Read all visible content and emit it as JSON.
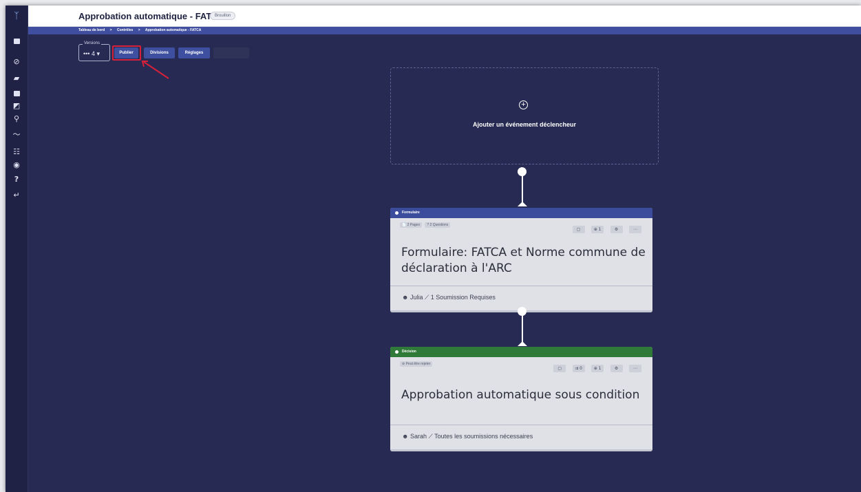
{
  "header": {
    "title": "Approbation automatique - FATCA",
    "status_badge": "Brouillon"
  },
  "breadcrumb": [
    "Tableau de bord",
    ">",
    "Contrôles",
    ">",
    "Approbation automatique - FATCA"
  ],
  "toolbar": {
    "versions_label": "Versions",
    "versions_value": "••• 4 ▾",
    "publish_label": "Publier",
    "divisions_label": "Divisions",
    "settings_label": "Réglages",
    "disabled_label": ""
  },
  "sidebar": {
    "icons": [
      "logo-icon",
      "dashboard-icon",
      "check-circle-icon",
      "chat-icon",
      "image-icon",
      "copy-icon",
      "search-icon",
      "trend-icon",
      "sliders-icon",
      "palette-icon",
      "help-icon",
      "return-icon"
    ]
  },
  "canvas": {
    "trigger_label": "Ajouter un événement déclencheur",
    "cards": [
      {
        "type_label": "Formulaire",
        "chips": [
          "📄 2 Pages",
          "? 2 Questions"
        ],
        "actions": [
          "▢",
          "⊕ 1",
          "⚙",
          "⋯"
        ],
        "title_line1": "Formulaire: FATCA et Norme commune de",
        "title_line2": "déclaration à l'ARC",
        "footer": "☻ Julia  ⟋ 1 Soumission Requises"
      },
      {
        "type_label": "Décision",
        "chips": [
          "⊘ Peut être rejeter"
        ],
        "actions": [
          "▢",
          "⇉ 0",
          "⊕ 1",
          "⚙",
          "⋯"
        ],
        "title_line1": "Approbation automatique sous condition",
        "footer": "☻ Sarah  ⟋ Toutes les soumissions nécessaires"
      }
    ]
  },
  "colors": {
    "canvas_bg": "#272a52",
    "header_blue": "#3c4c9c",
    "decision_green": "#2f7a38",
    "highlight_red": "#d7213a"
  }
}
